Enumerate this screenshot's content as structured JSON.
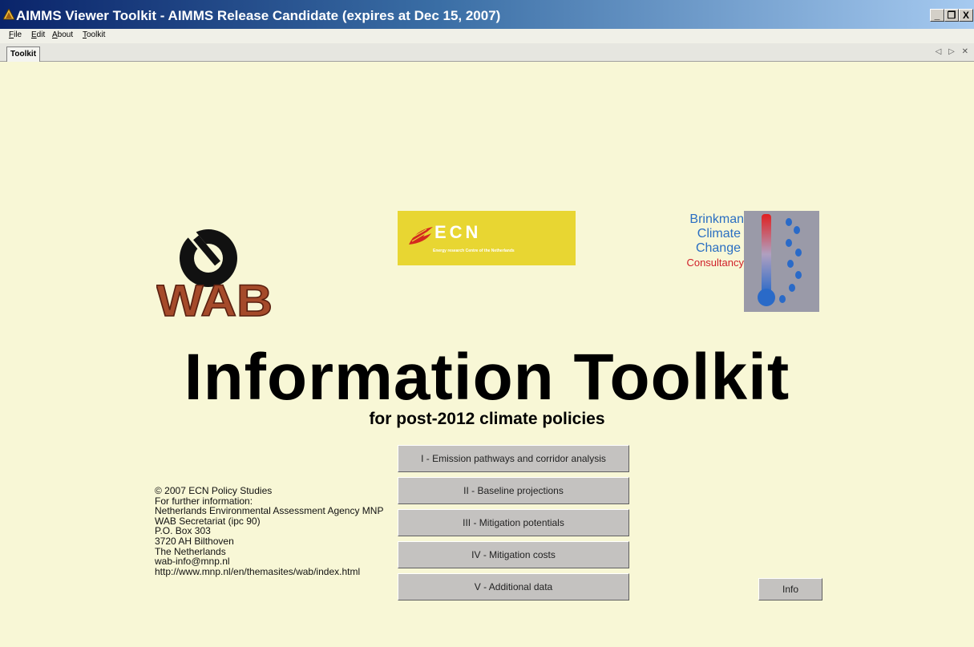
{
  "window": {
    "title": "AIMMS Viewer Toolkit - AIMMS Release Candidate (expires at Dec 15, 2007)",
    "minimize": "_",
    "restore": "❐",
    "close": "X"
  },
  "menu": {
    "items": [
      {
        "accel": "F",
        "rest": "ile"
      },
      {
        "accel": "E",
        "rest": "dit"
      },
      {
        "accel": "A",
        "rest": "bout"
      },
      {
        "accel": "T",
        "rest": "oolkit"
      }
    ]
  },
  "tabs": {
    "active": "Toolkit",
    "nav": "◁ ▷ ✕"
  },
  "logos": {
    "wab": "WAB",
    "ecn": "ECN",
    "ecn_sub": "Energy research Centre of the Netherlands",
    "brinkman": [
      "Brinkman",
      "Climate",
      "Change",
      "Consultancy"
    ]
  },
  "headline": {
    "title": "Information Toolkit",
    "subtitle": "for post-2012 climate policies"
  },
  "buttons": [
    "I  -  Emission pathways and corridor analysis",
    "II  -  Baseline projections",
    "III  -  Mitigation potentials",
    "IV  -  Mitigation costs",
    "V  -  Additional data"
  ],
  "info_button": "Info",
  "contact": [
    "© 2007 ECN Policy Studies",
    "For further information:",
    "Netherlands Environmental Assessment Agency MNP",
    "WAB Secretariat (ipc 90)",
    "P.O. Box 303",
    "3720 AH  Bilthoven",
    "The Netherlands",
    "wab-info@mnp.nl",
    "http://www.mnp.nl/en/themasites/wab/index.html"
  ],
  "colors": {
    "background": "#f8f7d6",
    "titlebar_start": "#0a246a",
    "button_face": "#c4c2c0",
    "ecn_yellow": "#e8d632",
    "ecn_red": "#d42a1e",
    "wab_brown": "#a54a2a",
    "brinkman_blue": "#2b6fc2",
    "brinkman_red": "#d0202a"
  }
}
